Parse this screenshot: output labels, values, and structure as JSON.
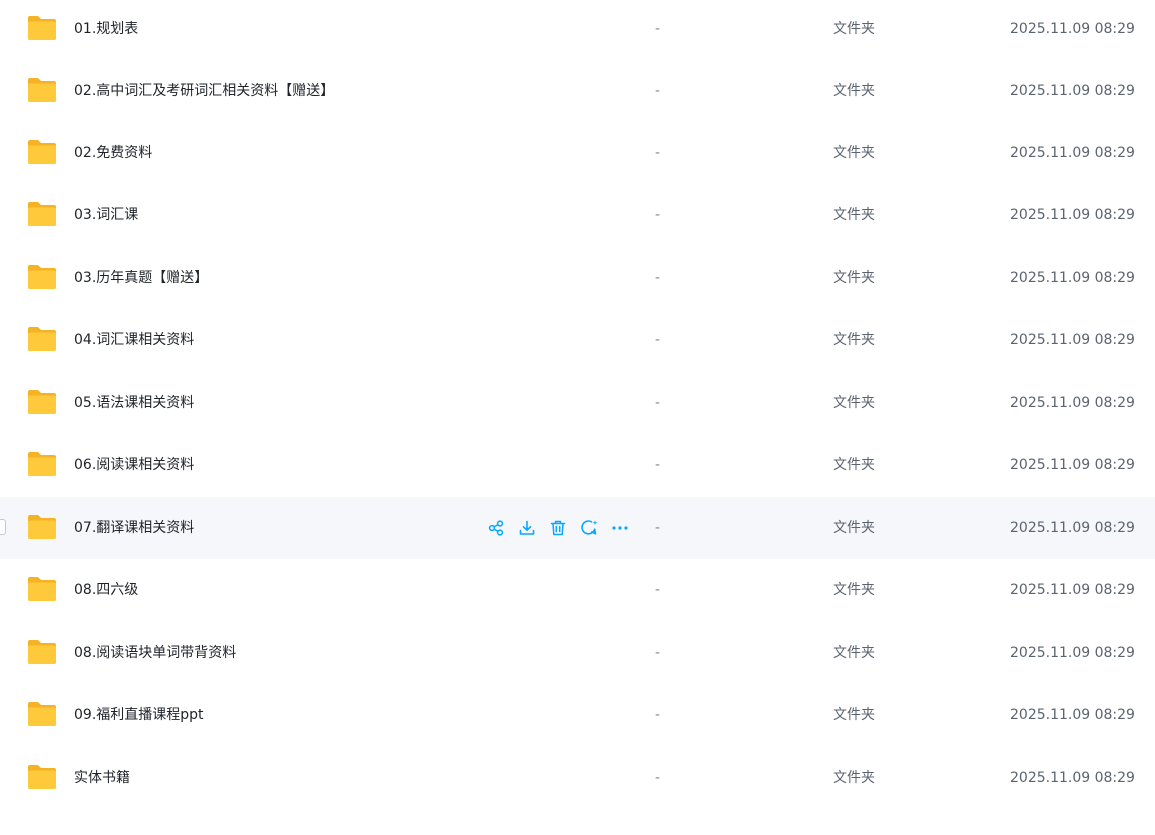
{
  "colors": {
    "accent": "#06a7ff",
    "folder_front": "#ffc93c",
    "folder_back": "#f5b324",
    "row_hover": "#f6f7fb"
  },
  "row_actions": {
    "icons": [
      "share-icon",
      "download-icon",
      "delete-icon",
      "comment-icon",
      "more-icon"
    ]
  },
  "files": [
    {
      "name": "01.规划表",
      "size": "-",
      "type": "文件夹",
      "date": "2025.11.09 08:29"
    },
    {
      "name": "02.高中词汇及考研词汇相关资料【赠送】",
      "size": "-",
      "type": "文件夹",
      "date": "2025.11.09 08:29"
    },
    {
      "name": "02.免费资料",
      "size": "-",
      "type": "文件夹",
      "date": "2025.11.09 08:29"
    },
    {
      "name": "03.词汇课",
      "size": "-",
      "type": "文件夹",
      "date": "2025.11.09 08:29"
    },
    {
      "name": "03.历年真题【赠送】",
      "size": "-",
      "type": "文件夹",
      "date": "2025.11.09 08:29"
    },
    {
      "name": "04.词汇课相关资料",
      "size": "-",
      "type": "文件夹",
      "date": "2025.11.09 08:29"
    },
    {
      "name": "05.语法课相关资料",
      "size": "-",
      "type": "文件夹",
      "date": "2025.11.09 08:29"
    },
    {
      "name": "06.阅读课相关资料",
      "size": "-",
      "type": "文件夹",
      "date": "2025.11.09 08:29"
    },
    {
      "name": "07.翻译课相关资料",
      "size": "-",
      "type": "文件夹",
      "date": "2025.11.09 08:29",
      "hovered": true
    },
    {
      "name": "08.四六级",
      "size": "-",
      "type": "文件夹",
      "date": "2025.11.09 08:29"
    },
    {
      "name": "08.阅读语块单词带背资料",
      "size": "-",
      "type": "文件夹",
      "date": "2025.11.09 08:29"
    },
    {
      "name": "09.福利直播课程ppt",
      "size": "-",
      "type": "文件夹",
      "date": "2025.11.09 08:29"
    },
    {
      "name": "实体书籍",
      "size": "-",
      "type": "文件夹",
      "date": "2025.11.09 08:29"
    }
  ]
}
